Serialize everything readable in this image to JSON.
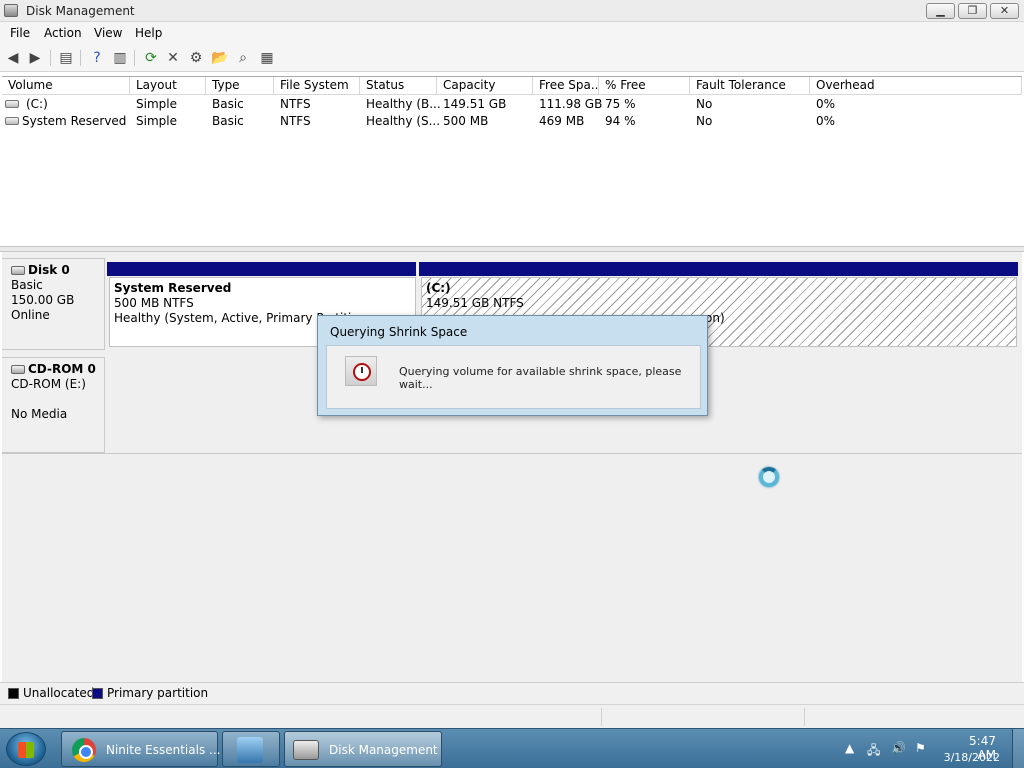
{
  "window": {
    "title": "Disk Management",
    "minimize": "▁",
    "maximize": "❐",
    "close": "✕"
  },
  "menu": [
    "File",
    "Action",
    "View",
    "Help"
  ],
  "toolbar": {
    "icons": [
      "back-icon",
      "forward-icon",
      "console-tree-icon",
      "help-icon",
      "properties-icon",
      "refresh-icon",
      "delete-icon",
      "settings-icon",
      "open-icon",
      "search-icon",
      "export-icon"
    ]
  },
  "volume_table": {
    "columns": [
      "Volume",
      "Layout",
      "Type",
      "File System",
      "Status",
      "Capacity",
      "Free Spa...",
      "% Free",
      "Fault Tolerance",
      "Overhead"
    ],
    "rows": [
      [
        "(C:)",
        "Simple",
        "Basic",
        "NTFS",
        "Healthy (B...",
        "149.51 GB",
        "111.98 GB",
        "75 %",
        "No",
        "0%"
      ],
      [
        "System Reserved",
        "Simple",
        "Basic",
        "NTFS",
        "Healthy (S...",
        "500 MB",
        "469 MB",
        "94 %",
        "No",
        "0%"
      ]
    ]
  },
  "disks": [
    {
      "name": "Disk 0",
      "lines": [
        "Basic",
        "150.00 GB",
        "Online"
      ],
      "partitions": [
        {
          "name": "System Reserved",
          "size": "500 MB NTFS",
          "status": "Healthy (System, Active, Primary Partiti"
        },
        {
          "name": "(C:)",
          "size": "149.51 GB NTFS",
          "status_tail": "on)"
        }
      ]
    },
    {
      "name": "CD-ROM 0",
      "lines": [
        "CD-ROM (E:)",
        "",
        "No Media"
      ]
    }
  ],
  "legend": [
    {
      "label": "Unallocated",
      "color": "#000000"
    },
    {
      "label": "Primary partition",
      "color": "#0b0b82"
    }
  ],
  "dialog": {
    "title": "Querying Shrink Space",
    "message": "Querying volume for available shrink space, please wait..."
  },
  "taskbar": {
    "tasks": [
      {
        "label": "Ninite Essentials ...",
        "icon": "chrome-icon"
      },
      {
        "label": "",
        "icon": "pinned-app-icon"
      },
      {
        "label": "Disk Management",
        "icon": "disk-management-icon"
      }
    ],
    "tray_icons": [
      "show-hidden-icons",
      "network-icon",
      "volume-icon",
      "action-center-icon"
    ],
    "time": "5:47 AM",
    "date": "3/18/2022"
  }
}
